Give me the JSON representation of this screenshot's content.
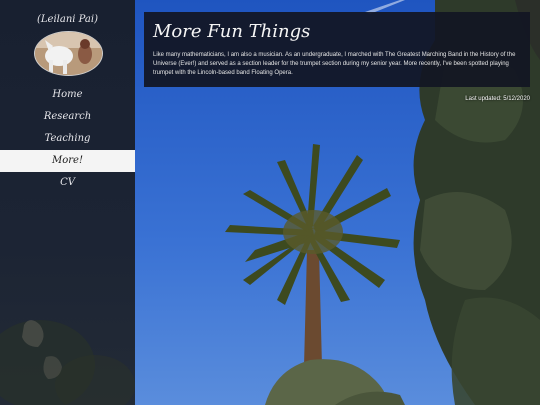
{
  "sidebar": {
    "site_name": "(Leilani Pai)",
    "nav": [
      {
        "label": "Home",
        "active": false
      },
      {
        "label": "Research",
        "active": false
      },
      {
        "label": "Teaching",
        "active": false
      },
      {
        "label": "More!",
        "active": true
      },
      {
        "label": "CV",
        "active": false
      }
    ]
  },
  "main": {
    "title": "More Fun Things",
    "paragraph": "Like many mathematicians, I am also a musician. As an undergraduate, I marched with The Greatest Marching Band in the History of the Universe (Ever!) and served as a section leader for the trumpet section during my senior year. More recently, I've been spotted playing trumpet with the Lincoln-based band Floating Opera.",
    "last_updated": "Last updated: 5/12/2020"
  },
  "colors": {
    "sidebar_bg": "#1c2434",
    "active_nav_bg": "#f4f4f4",
    "card_bg": "#12162a",
    "sky": "#2c62c4"
  }
}
